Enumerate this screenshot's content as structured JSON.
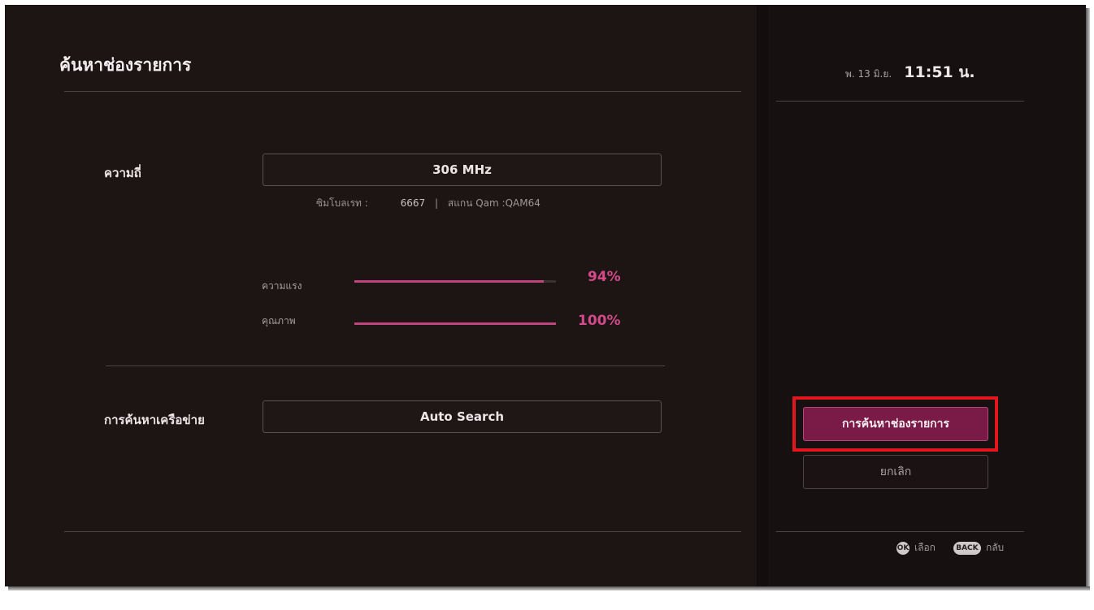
{
  "header": {
    "title": "ค้นหาช่องรายการ",
    "date": "พ. 13 มิ.ย.",
    "time": "11:51 น."
  },
  "frequency": {
    "label": "ความถี่",
    "value": "306 MHz",
    "symbol_rate_label": "ซิมโบลเรท :",
    "symbol_rate_value": "6667",
    "separator": "|",
    "scan_label": "สแกน Qam :QAM64"
  },
  "signal": {
    "strength_label": "ความแรง",
    "strength_value": "94%",
    "strength_level": 0.94,
    "quality_label": "คุณภาพ",
    "quality_value": "100%",
    "quality_level": 1.0
  },
  "network_search": {
    "label": "การค้นหาเครือข่าย",
    "value": "Auto Search"
  },
  "buttons": {
    "search": "การค้นหาช่องรายการ",
    "cancel": "ยกเลิก"
  },
  "footer": {
    "ok_key": "OK",
    "ok_label": "เลือก",
    "back_key": "BACK",
    "back_label": "กลับ"
  },
  "colors": {
    "accent": "#c0457f",
    "button_primary": "#7a1a47",
    "highlight_border": "#e0171f",
    "background": "#1b1212"
  }
}
